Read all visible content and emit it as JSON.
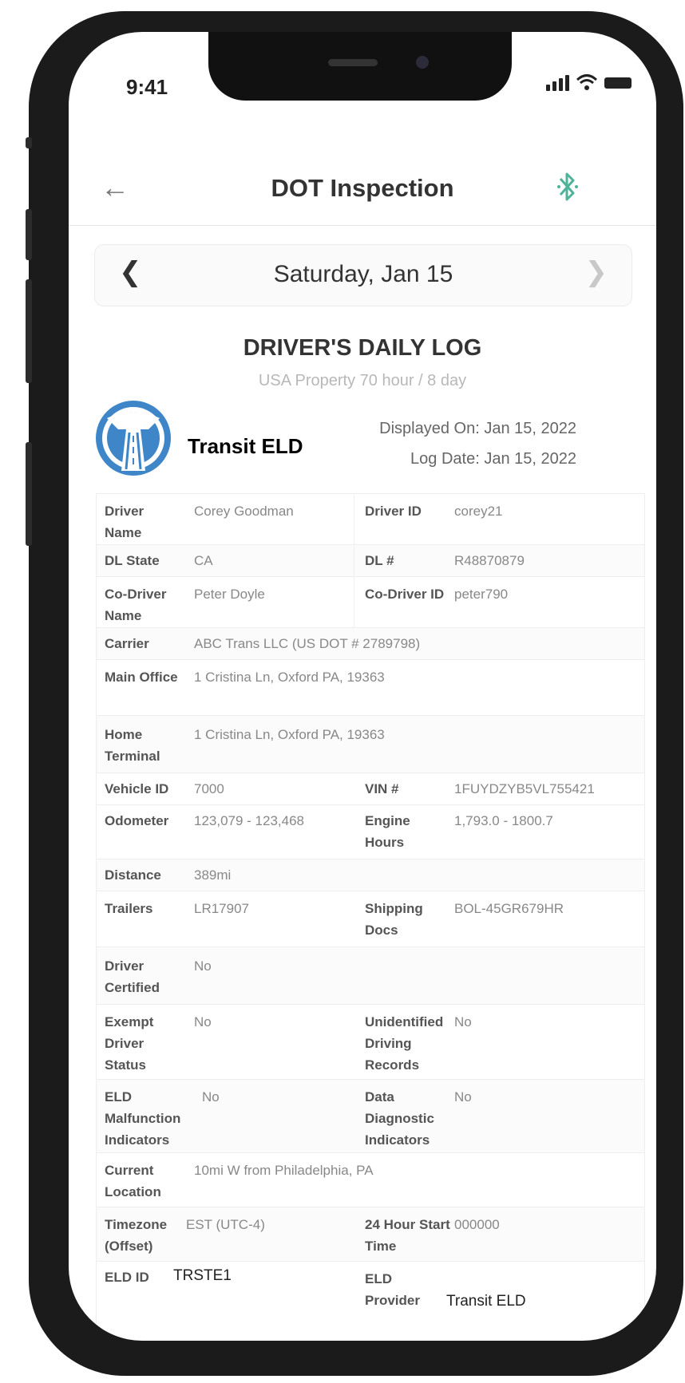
{
  "status_bar": {
    "time": "9:41"
  },
  "header": {
    "title": "DOT Inspection"
  },
  "date_nav": {
    "date": "Saturday, Jan 15"
  },
  "log": {
    "title": "DRIVER'S DAILY LOG",
    "subtitle": "USA Property 70 hour / 8 day",
    "brand": "Transit ELD",
    "displayed_on": "Displayed On: Jan 15, 2022",
    "log_date": "Log Date: Jan 15, 2022"
  },
  "fields": {
    "driver_name_label": "Driver Name",
    "driver_name": "Corey Goodman",
    "driver_id_label": "Driver ID",
    "driver_id": "corey21",
    "dl_state_label": "DL State",
    "dl_state": "CA",
    "dl_num_label": "DL #",
    "dl_num": "R48870879",
    "co_driver_name_label": "Co-Driver Name",
    "co_driver_name": "Peter Doyle",
    "co_driver_id_label": "Co-Driver ID",
    "co_driver_id": "peter790",
    "carrier_label": "Carrier",
    "carrier": "ABC Trans LLC (US DOT # 2789798)",
    "main_office_label": "Main Office",
    "main_office": "1 Cristina Ln, Oxford PA, 19363",
    "home_terminal_label": "Home Terminal",
    "home_terminal": "1 Cristina Ln, Oxford PA, 19363",
    "vehicle_id_label": "Vehicle ID",
    "vehicle_id": "7000",
    "vin_label": "VIN #",
    "vin": "1FUYDZYB5VL755421",
    "odometer_label": "Odometer",
    "odometer": "123,079 - 123,468",
    "engine_hours_label": "Engine Hours",
    "engine_hours": "1,793.0 - 1800.7",
    "distance_label": "Distance",
    "distance": "389mi",
    "trailers_label": "Trailers",
    "trailers": "LR17907",
    "shipping_docs_label": "Shipping Docs",
    "shipping_docs": "BOL-45GR679HR",
    "driver_certified_label": "Driver Certified",
    "driver_certified": "No",
    "exempt_label": "Exempt Driver Status",
    "exempt": "No",
    "unidentified_label": "Unidentified Driving Records",
    "unidentified": "No",
    "eld_malfunction_label": "ELD Malfunction Indicators",
    "eld_malfunction": "No",
    "data_diagnostic_label": "Data Diagnostic Indicators",
    "data_diagnostic": "No",
    "current_location_label": "Current Location",
    "current_location": "10mi W from Philadelphia, PA",
    "timezone_label": "Timezone (Offset)",
    "timezone": "EST (UTC-4)",
    "start_time_label": "24 Hour Start Time",
    "start_time": "000000",
    "eld_id_label": "ELD ID",
    "eld_id": "TRSTE1",
    "eld_provider_label": "ELD Provider",
    "eld_provider": "Transit ELD"
  },
  "colors": {
    "logo_blue": "#3f86c8",
    "bluetooth_green": "#4fb39a"
  },
  "icons": [
    "back-arrow-icon",
    "bluetooth-icon",
    "chevron-left-icon",
    "chevron-right-icon",
    "signal-icon",
    "wifi-icon",
    "battery-icon",
    "transit-eld-logo"
  ]
}
